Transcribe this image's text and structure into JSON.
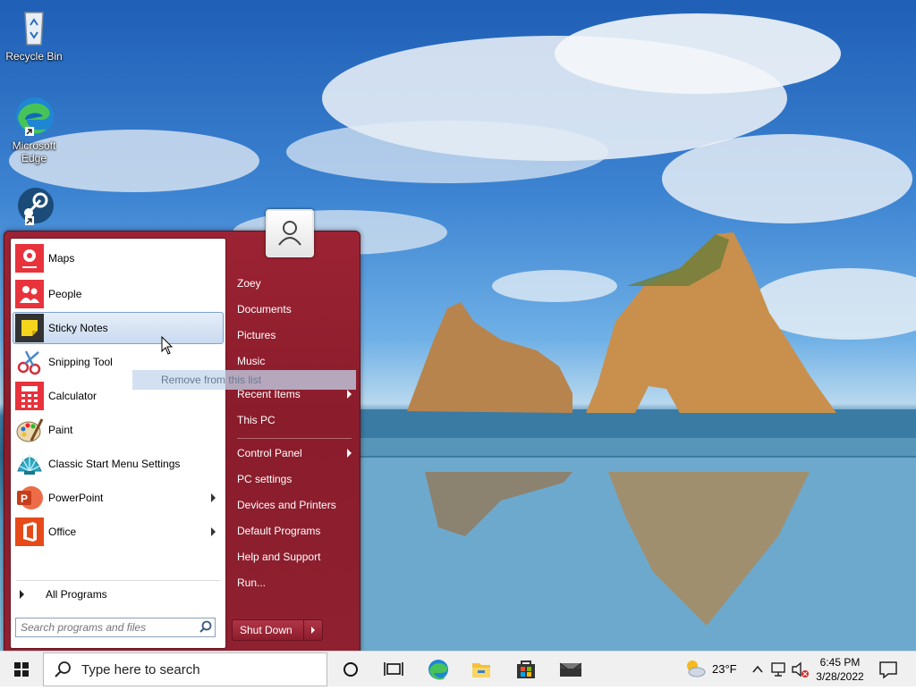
{
  "desktop": {
    "icons": [
      {
        "label": "Recycle Bin"
      },
      {
        "label": "Microsoft Edge"
      },
      {
        "label": ""
      }
    ]
  },
  "start_menu": {
    "programs": [
      {
        "label": "Maps"
      },
      {
        "label": "People"
      },
      {
        "label": "Sticky Notes"
      },
      {
        "label": "Snipping Tool"
      },
      {
        "label": "Calculator"
      },
      {
        "label": "Paint"
      },
      {
        "label": "Classic Start Menu Settings"
      },
      {
        "label": "PowerPoint"
      },
      {
        "label": "Office"
      }
    ],
    "all_programs": "All Programs",
    "search_placeholder": "Search programs and files",
    "context_item": "Remove from this list",
    "right_items": [
      {
        "label": "Zoey"
      },
      {
        "label": "Documents"
      },
      {
        "label": "Pictures"
      },
      {
        "label": "Music"
      },
      {
        "label": "Recent Items"
      },
      {
        "label": "This PC"
      },
      {
        "label": "Control Panel"
      },
      {
        "label": "PC settings"
      },
      {
        "label": "Devices and Printers"
      },
      {
        "label": "Default Programs"
      },
      {
        "label": "Help and Support"
      },
      {
        "label": "Run..."
      }
    ],
    "shutdown_label": "Shut Down"
  },
  "taskbar": {
    "search_text": "Type here to search",
    "weather_temp": "23°F",
    "time": "6:45 PM",
    "date": "3/28/2022"
  },
  "colors": {
    "menu_accent": "#8e1f2e",
    "hover_blue": "#c9daf0"
  }
}
